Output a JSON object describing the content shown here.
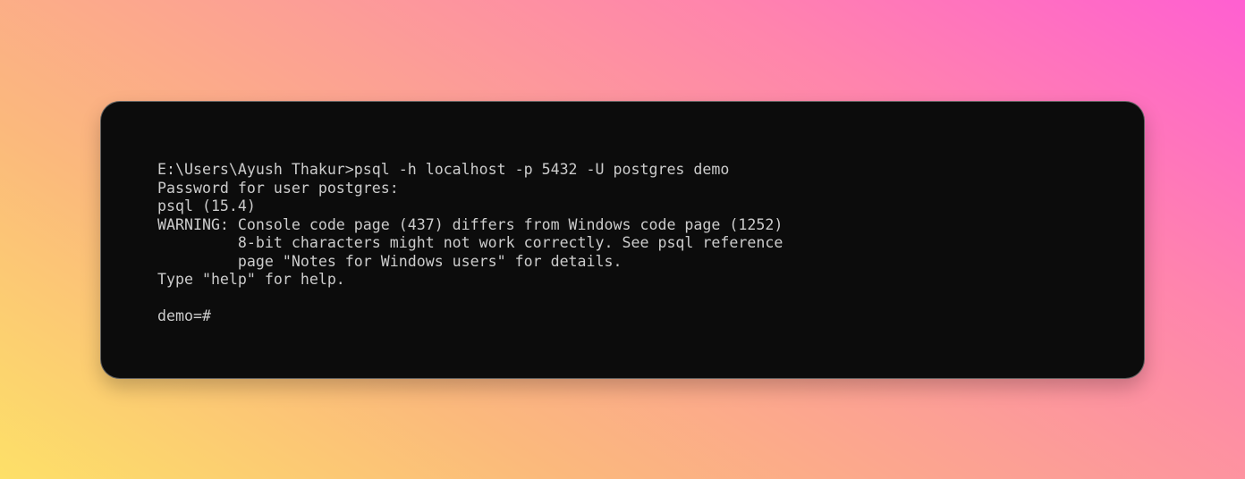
{
  "terminal": {
    "lines": [
      "E:\\Users\\Ayush Thakur>psql -h localhost -p 5432 -U postgres demo",
      "Password for user postgres:",
      "psql (15.4)",
      "WARNING: Console code page (437) differs from Windows code page (1252)",
      "         8-bit characters might not work correctly. See psql reference",
      "         page \"Notes for Windows users\" for details.",
      "Type \"help\" for help.",
      "",
      "demo=#"
    ]
  },
  "colors": {
    "terminal_background": "#0c0c0c",
    "terminal_text": "#cccccc"
  }
}
